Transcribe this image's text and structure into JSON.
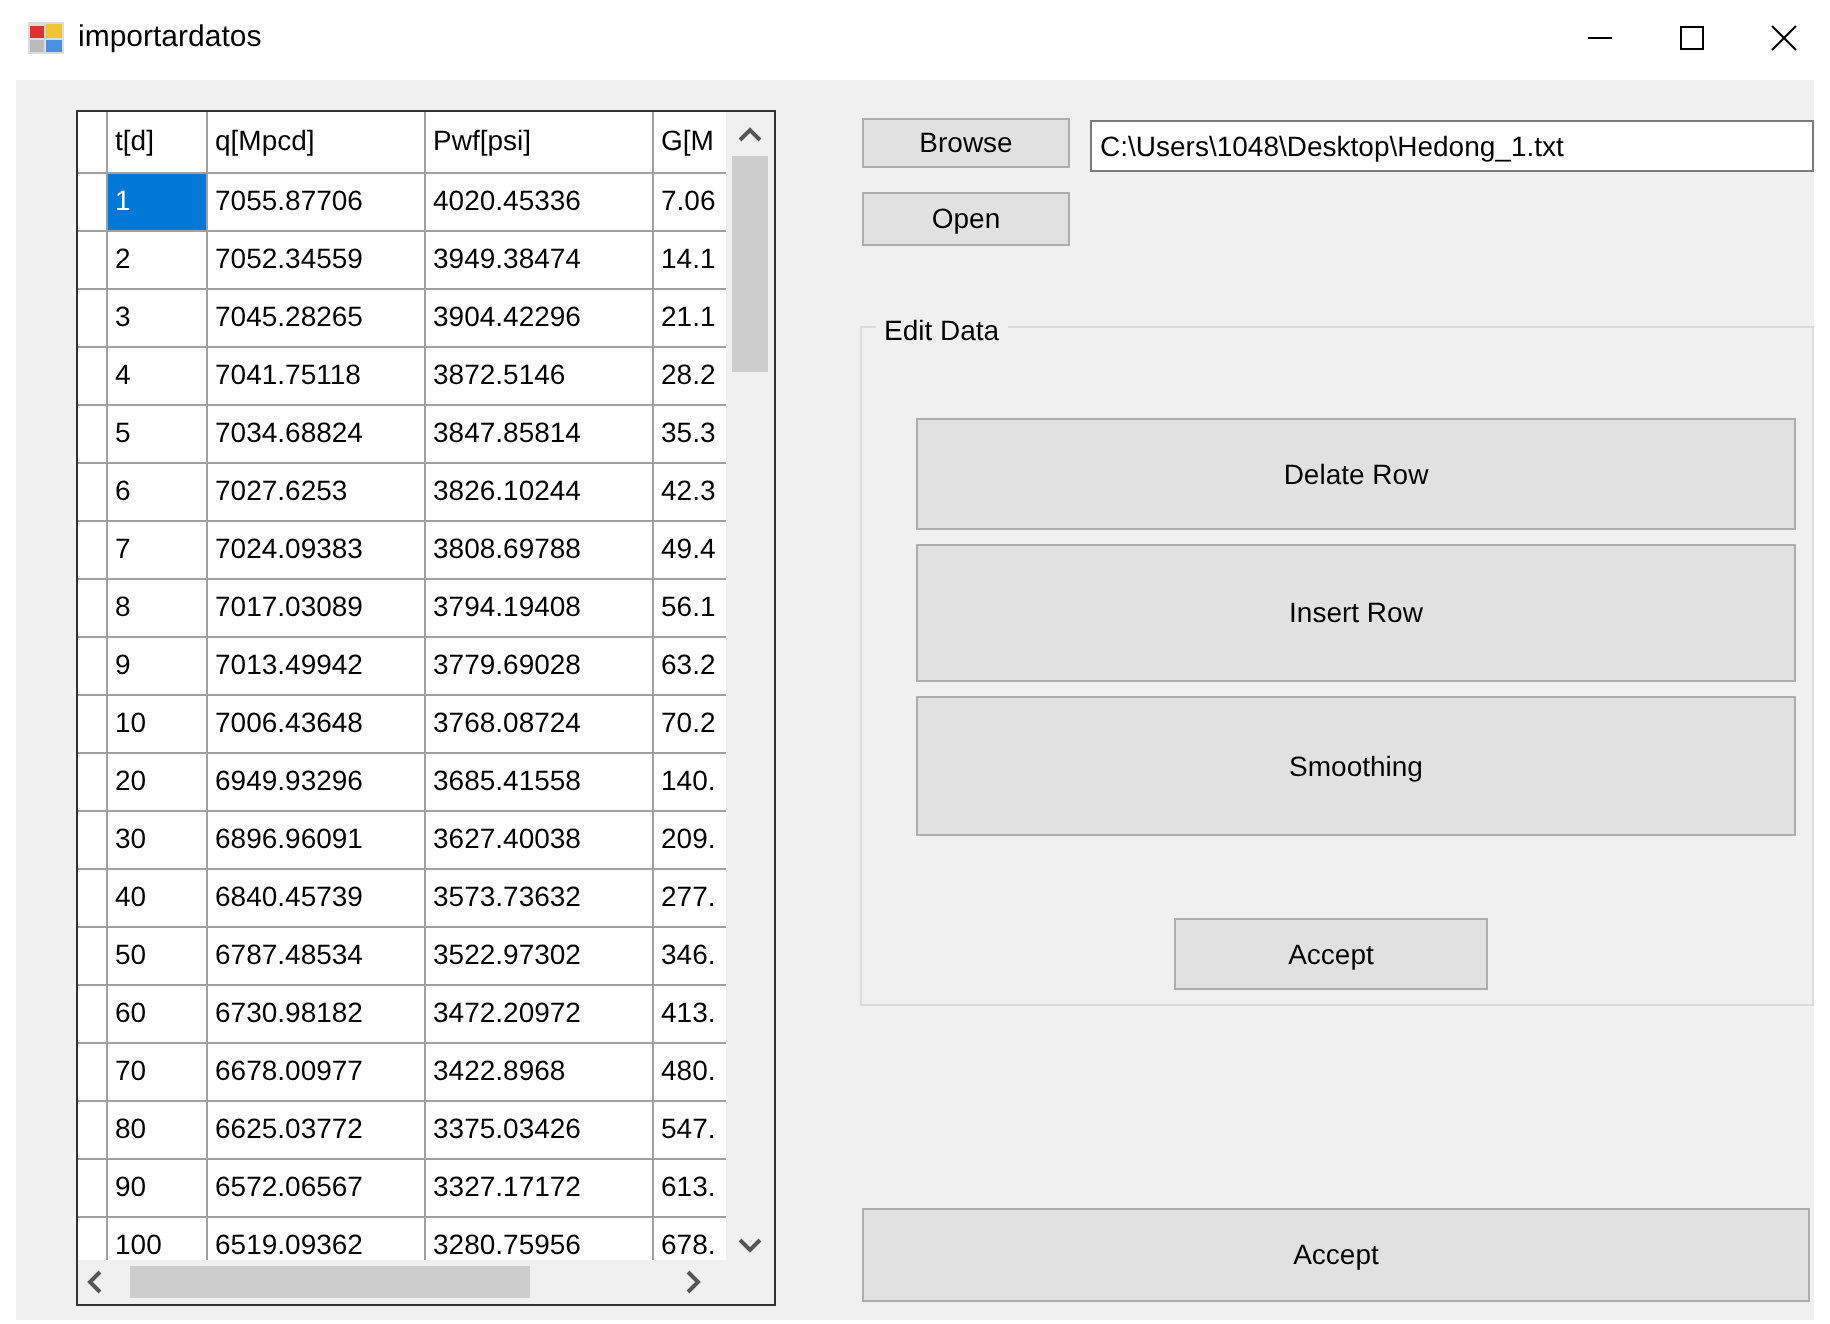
{
  "window": {
    "title": "importardatos"
  },
  "grid": {
    "columns": [
      "t[d]",
      "q[Mpcd]",
      "Pwf[psi]",
      "G[M"
    ],
    "rows": [
      {
        "cells": [
          {
            "text": "1",
            "selected": true
          },
          {
            "text": "7055.87706",
            "selected": false
          },
          {
            "text": "4020.45336",
            "selected": false
          },
          {
            "text": "7.06",
            "selected": false
          }
        ]
      },
      {
        "cells": [
          {
            "text": "2",
            "selected": false
          },
          {
            "text": "7052.34559",
            "selected": false
          },
          {
            "text": "3949.38474",
            "selected": false
          },
          {
            "text": "14.1",
            "selected": false
          }
        ]
      },
      {
        "cells": [
          {
            "text": "3",
            "selected": false
          },
          {
            "text": "7045.28265",
            "selected": false
          },
          {
            "text": "3904.42296",
            "selected": false
          },
          {
            "text": "21.1",
            "selected": false
          }
        ]
      },
      {
        "cells": [
          {
            "text": "4",
            "selected": false
          },
          {
            "text": "7041.75118",
            "selected": false
          },
          {
            "text": "3872.5146",
            "selected": false
          },
          {
            "text": "28.2",
            "selected": false
          }
        ]
      },
      {
        "cells": [
          {
            "text": "5",
            "selected": false
          },
          {
            "text": "7034.68824",
            "selected": false
          },
          {
            "text": "3847.85814",
            "selected": false
          },
          {
            "text": "35.3",
            "selected": false
          }
        ]
      },
      {
        "cells": [
          {
            "text": "6",
            "selected": false
          },
          {
            "text": "7027.6253",
            "selected": false
          },
          {
            "text": "3826.10244",
            "selected": false
          },
          {
            "text": "42.3",
            "selected": false
          }
        ]
      },
      {
        "cells": [
          {
            "text": "7",
            "selected": false
          },
          {
            "text": "7024.09383",
            "selected": false
          },
          {
            "text": "3808.69788",
            "selected": false
          },
          {
            "text": "49.4",
            "selected": false
          }
        ]
      },
      {
        "cells": [
          {
            "text": "8",
            "selected": false
          },
          {
            "text": "7017.03089",
            "selected": false
          },
          {
            "text": "3794.19408",
            "selected": false
          },
          {
            "text": "56.1",
            "selected": false
          }
        ]
      },
      {
        "cells": [
          {
            "text": "9",
            "selected": false
          },
          {
            "text": "7013.49942",
            "selected": false
          },
          {
            "text": "3779.69028",
            "selected": false
          },
          {
            "text": "63.2",
            "selected": false
          }
        ]
      },
      {
        "cells": [
          {
            "text": "10",
            "selected": false
          },
          {
            "text": "7006.43648",
            "selected": false
          },
          {
            "text": "3768.08724",
            "selected": false
          },
          {
            "text": "70.2",
            "selected": false
          }
        ]
      },
      {
        "cells": [
          {
            "text": "20",
            "selected": false
          },
          {
            "text": "6949.93296",
            "selected": false
          },
          {
            "text": "3685.41558",
            "selected": false
          },
          {
            "text": "140.",
            "selected": false
          }
        ]
      },
      {
        "cells": [
          {
            "text": "30",
            "selected": false
          },
          {
            "text": "6896.96091",
            "selected": false
          },
          {
            "text": "3627.40038",
            "selected": false
          },
          {
            "text": "209.",
            "selected": false
          }
        ]
      },
      {
        "cells": [
          {
            "text": "40",
            "selected": false
          },
          {
            "text": "6840.45739",
            "selected": false
          },
          {
            "text": "3573.73632",
            "selected": false
          },
          {
            "text": "277.",
            "selected": false
          }
        ]
      },
      {
        "cells": [
          {
            "text": "50",
            "selected": false
          },
          {
            "text": "6787.48534",
            "selected": false
          },
          {
            "text": "3522.97302",
            "selected": false
          },
          {
            "text": "346.",
            "selected": false
          }
        ]
      },
      {
        "cells": [
          {
            "text": "60",
            "selected": false
          },
          {
            "text": "6730.98182",
            "selected": false
          },
          {
            "text": "3472.20972",
            "selected": false
          },
          {
            "text": "413.",
            "selected": false
          }
        ]
      },
      {
        "cells": [
          {
            "text": "70",
            "selected": false
          },
          {
            "text": "6678.00977",
            "selected": false
          },
          {
            "text": "3422.8968",
            "selected": false
          },
          {
            "text": "480.",
            "selected": false
          }
        ]
      },
      {
        "cells": [
          {
            "text": "80",
            "selected": false
          },
          {
            "text": "6625.03772",
            "selected": false
          },
          {
            "text": "3375.03426",
            "selected": false
          },
          {
            "text": "547.",
            "selected": false
          }
        ]
      },
      {
        "cells": [
          {
            "text": "90",
            "selected": false
          },
          {
            "text": "6572.06567",
            "selected": false
          },
          {
            "text": "3327.17172",
            "selected": false
          },
          {
            "text": "613.",
            "selected": false
          }
        ]
      },
      {
        "cells": [
          {
            "text": "100",
            "selected": false
          },
          {
            "text": "6519.09362",
            "selected": false
          },
          {
            "text": "3280.75956",
            "selected": false
          },
          {
            "text": "678.",
            "selected": false
          }
        ]
      }
    ]
  },
  "file": {
    "browse_button": "Browse",
    "path": "C:\\Users\\1048\\Desktop\\Hedong_1.txt",
    "open_button": "Open"
  },
  "edit_data": {
    "title": "Edit Data",
    "buttons": [
      "Delate Row",
      "Insert Row",
      "Smoothing"
    ],
    "accept_button": "Accept"
  },
  "accept_button": "Accept"
}
